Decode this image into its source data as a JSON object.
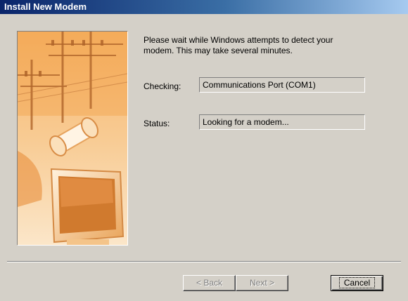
{
  "window": {
    "title": "Install New Modem"
  },
  "intro_text": "Please wait while Windows attempts to detect your\nmodem.  This may take several minutes.",
  "checking": {
    "label": "Checking:",
    "value": "Communications Port (COM1)"
  },
  "status": {
    "label": "Status:",
    "value": "Looking for a modem..."
  },
  "buttons": {
    "back": "< Back",
    "next": "Next >",
    "cancel": "Cancel"
  },
  "colors": {
    "title_bar_start": "#0a246a",
    "title_bar_end": "#a6caf0",
    "dialog_face": "#d4d0c8",
    "art_tone": "#f2a64c"
  }
}
